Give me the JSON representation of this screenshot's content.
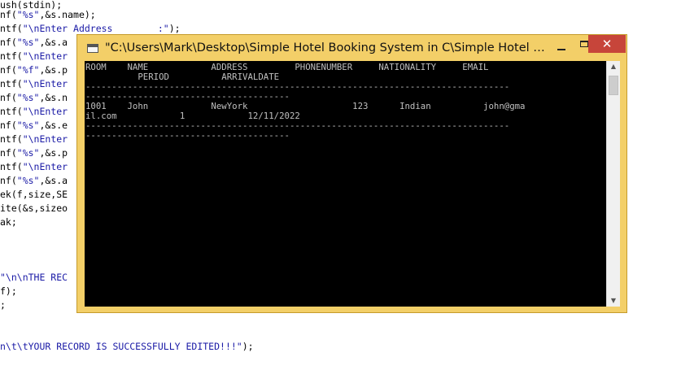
{
  "editor": {
    "lines": [
      {
        "a": "ush(stdin);",
        "b": "",
        "c": ""
      },
      {
        "a": "nf(",
        "b": "\"%s\"",
        "c": ",&s.name);"
      },
      {
        "a": "ntf(",
        "b": "\"\\nEnter Address        :\"",
        "c": ");"
      },
      {
        "a": "nf(",
        "b": "\"%s\"",
        "c": ",&s.a"
      },
      {
        "a": "ntf(",
        "b": "\"\\nEnter",
        "c": ""
      },
      {
        "a": "nf(",
        "b": "\"%f\"",
        "c": ",&s.p"
      },
      {
        "a": "ntf(",
        "b": "\"\\nEnter",
        "c": ""
      },
      {
        "a": "nf(",
        "b": "\"%s\"",
        "c": ",&s.n"
      },
      {
        "a": "ntf(",
        "b": "\"\\nEnter",
        "c": ""
      },
      {
        "a": "nf(",
        "b": "\"%s\"",
        "c": ",&s.e"
      },
      {
        "a": "ntf(",
        "b": "\"\\nEnter",
        "c": ""
      },
      {
        "a": "nf(",
        "b": "\"%s\"",
        "c": ",&s.p"
      },
      {
        "a": "ntf(",
        "b": "\"\\nEnter",
        "c": ""
      },
      {
        "a": "nf(",
        "b": "\"%s\"",
        "c": ",&s.a"
      },
      {
        "a": "ek(f,size,SE",
        "b": "",
        "c": ""
      },
      {
        "a": "ite(&s,sizeo",
        "b": "",
        "c": ""
      },
      {
        "a": "ak;",
        "b": "",
        "c": ""
      },
      {
        "a": "",
        "b": "",
        "c": ""
      },
      {
        "a": "",
        "b": "",
        "c": ""
      },
      {
        "a": "",
        "b": "\"\\n\\nTHE REC",
        "c": ""
      },
      {
        "a": "f);",
        "b": "",
        "c": ""
      },
      {
        "a": ";",
        "b": "",
        "c": ""
      },
      {
        "a": "",
        "b": "",
        "c": ""
      },
      {
        "a": "",
        "b": "",
        "c": ""
      },
      {
        "a": "",
        "b": "n\\t\\tYOUR RECORD IS SUCCESSFULLY EDITED!!!\"",
        "c": ");"
      }
    ]
  },
  "window": {
    "title": "\"C:\\Users\\Mark\\Desktop\\Simple Hotel Booking System in C\\Simple Hotel Booki...",
    "minimize_icon": "minimize-icon",
    "maximize_icon": "maximize-icon",
    "close_label": "✕"
  },
  "console": {
    "lines": [
      "ROOM    NAME            ADDRESS         PHONENUMBER     NATIONALITY     EMAIL",
      "          PERIOD          ARRIVALDATE",
      "---------------------------------------------------------------------------------",
      "---------------------------------------",
      "",
      "1001    John            NewYork                    123      Indian          john@gma",
      "il.com            1            12/11/2022",
      "---------------------------------------------------------------------------------",
      "---------------------------------------"
    ]
  },
  "scrollbar": {
    "up_arrow": "▲",
    "down_arrow": "▼"
  }
}
